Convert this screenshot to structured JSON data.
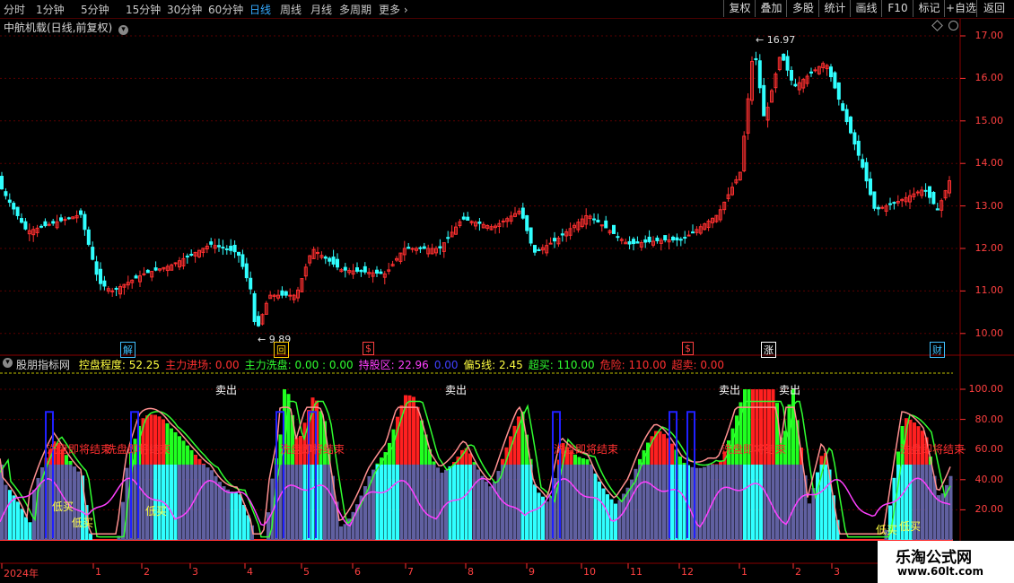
{
  "toolbar": {
    "periods": [
      "分时",
      "1分钟",
      "5分钟",
      "15分钟",
      "30分钟",
      "60分钟",
      "日线",
      "周线",
      "月线",
      "多周期",
      "更多"
    ],
    "active": "日线",
    "more_icon": "chevron-right-icon",
    "right_buttons": [
      "复权",
      "叠加",
      "多股",
      "统计",
      "画线",
      "F10",
      "标记",
      "+自选",
      "返回"
    ]
  },
  "stock": {
    "title": "中航机载(日线,前复权)",
    "dropdown_icon": "chevron-down-icon",
    "high_label": "16.97",
    "low_label": "9.89"
  },
  "price_axis": [
    "17.00",
    "16.00",
    "15.00",
    "14.00",
    "13.00",
    "12.00",
    "11.00",
    "10.00"
  ],
  "indicator_axis": [
    "100.00",
    "80.00",
    "60.00",
    "40.00",
    "20.00"
  ],
  "events": [
    {
      "label": "解",
      "color": "#40c0ff"
    },
    {
      "label": "回",
      "color": "#ffcc00"
    },
    {
      "label": "$",
      "color": "#ff4040"
    },
    {
      "label": "$",
      "color": "#ff4040"
    },
    {
      "label": "涨",
      "color": "#ffffff"
    },
    {
      "label": "财",
      "color": "#40c0ff"
    }
  ],
  "indicator": {
    "name": "股朋指标网",
    "fields": [
      {
        "label": "控盘程度: 52.25",
        "color": "#ffff40"
      },
      {
        "label": "主力进场: 0.00",
        "color": "#ff3030"
      },
      {
        "label": "主力洗盘: 0.00 : 0.00",
        "color": "#30ff30"
      },
      {
        "label": "持股区: 22.96",
        "color": "#ff40ff"
      },
      {
        "label": "0.00",
        "color": "#4040ff"
      },
      {
        "label": "偏5线: 2.45",
        "color": "#ffff40"
      },
      {
        "label": "超买: 110.00",
        "color": "#30ff30"
      },
      {
        "label": "危险: 110.00",
        "color": "#ff3030"
      },
      {
        "label": "超卖: 0.00",
        "color": "#ff3030"
      }
    ]
  },
  "signals": {
    "sell": [
      "卖出",
      "卖出",
      "卖出",
      "卖出"
    ],
    "low_buy": [
      "低买",
      "低买",
      "低买",
      "低买",
      "低买"
    ],
    "wash": [
      "洗盘即将结束",
      "洗盘即将结束",
      "洗盘即将结束",
      "洗盘即将结束",
      "洗盘即将结束",
      "洗盘即将结束"
    ]
  },
  "x_axis": [
    "2024年",
    "1",
    "2",
    "3",
    "4",
    "5",
    "6",
    "7",
    "8",
    "9",
    "10",
    "11",
    "12",
    "1",
    "2",
    "3"
  ],
  "watermark": {
    "title": "乐淘公式网",
    "url": "www.60lt.com"
  },
  "colors": {
    "up": "#ff3030",
    "down": "#30ffff",
    "grid": "#5a0000",
    "background": "#000000",
    "volume_fill": "#6060a0"
  }
}
